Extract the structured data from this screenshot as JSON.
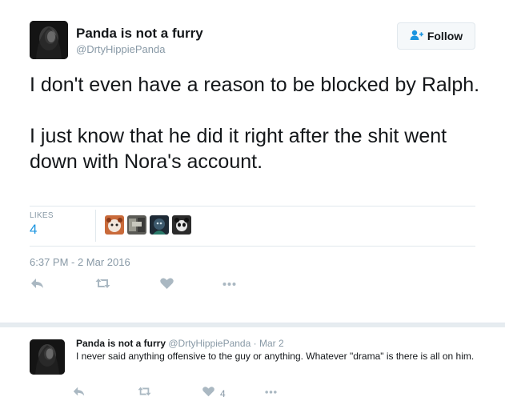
{
  "tweet": {
    "author_name": "Panda is not a furry",
    "author_handle": "@DrtyHippiePanda",
    "follow_label": "Follow",
    "text": "I don't even have a reason to be blocked by Ralph.\n\nI just know that he did it right after the shit went down with Nora's account.",
    "likes_label": "LIKES",
    "likes_count": "4",
    "timestamp": "6:37 PM - 2 Mar 2016",
    "actions": [
      "reply-icon",
      "retweet-icon",
      "heart-icon",
      "more-icon"
    ]
  },
  "reply": {
    "author_name": "Panda is not a furry",
    "author_handle": "@DrtyHippiePanda",
    "separator": "·",
    "date": "Mar 2",
    "text": "I never said anything offensive to the guy or anything. Whatever \"drama\" is there is all on him.",
    "like_count": "4",
    "actions": [
      "reply-icon",
      "retweet-icon",
      "heart-icon",
      "more-icon"
    ]
  },
  "colors": {
    "link_blue": "#1b95e0",
    "secondary_text": "#8899a6",
    "icon_gray": "#aab8c2",
    "border": "#e1e8ed"
  }
}
